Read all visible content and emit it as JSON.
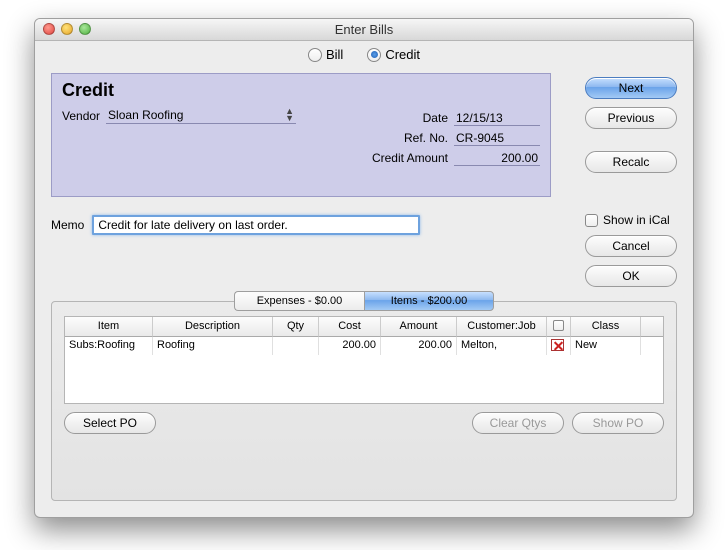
{
  "window": {
    "title": "Enter Bills"
  },
  "type_radio": {
    "bill_label": "Bill",
    "credit_label": "Credit",
    "selected": "credit"
  },
  "side_buttons": {
    "next": "Next",
    "previous": "Previous",
    "recalc": "Recalc",
    "show_in_ical": "Show in iCal",
    "cancel": "Cancel",
    "ok": "OK"
  },
  "credit_panel": {
    "title": "Credit",
    "vendor_label": "Vendor",
    "vendor_value": "Sloan Roofing",
    "date_label": "Date",
    "date_value": "12/15/13",
    "refno_label": "Ref. No.",
    "refno_value": "CR-9045",
    "amount_label": "Credit Amount",
    "amount_value": "200.00"
  },
  "memo": {
    "label": "Memo",
    "value": "Credit for late delivery on last order."
  },
  "tabs": {
    "expenses": "Expenses - $0.00",
    "items": "Items - $200.00",
    "active": "items"
  },
  "table": {
    "headers": {
      "item": "Item",
      "description": "Description",
      "qty": "Qty",
      "cost": "Cost",
      "amount": "Amount",
      "customer": "Customer:Job",
      "class": "Class"
    },
    "rows": [
      {
        "item": "Subs:Roofing",
        "description": "Roofing",
        "qty": "",
        "cost": "200.00",
        "amount": "200.00",
        "customer": "Melton,",
        "billable": false,
        "class": "New"
      }
    ]
  },
  "panel_buttons": {
    "select_po": "Select PO",
    "clear_qtys": "Clear Qtys",
    "show_po": "Show PO"
  }
}
